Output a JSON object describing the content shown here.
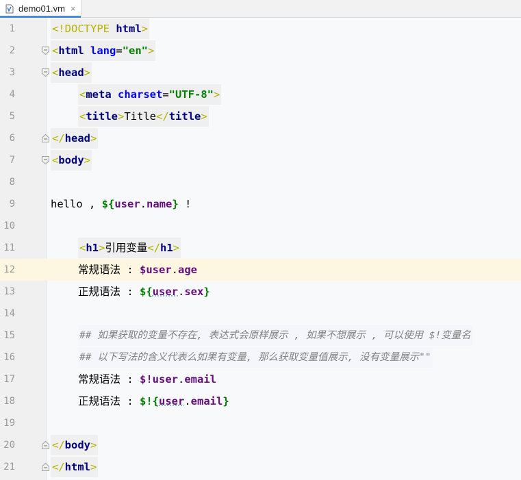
{
  "tab": {
    "filename": "demo01.vm",
    "close_glyph": "×",
    "icon": "velocity-file-icon"
  },
  "editor": {
    "current_line": 12,
    "lines": [
      {
        "num": "1"
      },
      {
        "num": "2"
      },
      {
        "num": "3"
      },
      {
        "num": "4"
      },
      {
        "num": "5"
      },
      {
        "num": "6"
      },
      {
        "num": "7"
      },
      {
        "num": "8"
      },
      {
        "num": "9"
      },
      {
        "num": "10"
      },
      {
        "num": "11"
      },
      {
        "num": "12"
      },
      {
        "num": "13"
      },
      {
        "num": "14"
      },
      {
        "num": "15"
      },
      {
        "num": "16"
      },
      {
        "num": "17"
      },
      {
        "num": "18"
      },
      {
        "num": "19"
      },
      {
        "num": "20"
      },
      {
        "num": "21"
      }
    ],
    "code": {
      "l1_open": "<!DOCTYPE ",
      "l1_kw": "html",
      "l1_close": ">",
      "l2_open": "<",
      "l2_kw": "html",
      "l2_attr": " lang",
      "l2_eq": "=",
      "l2_str": "\"en\"",
      "l2_close": ">",
      "l3_open": "<",
      "l3_kw": "head",
      "l3_close": ">",
      "l4_open": "<",
      "l4_kw": "meta",
      "l4_attr": " charset",
      "l4_eq": "=",
      "l4_str": "\"UTF-8\"",
      "l4_close": ">",
      "l5_open": "<",
      "l5_kw": "title",
      "l5_close": ">",
      "l5_text": "Title",
      "l5_open2": "</",
      "l5_kw2": "title",
      "l5_close2": ">",
      "l6_open": "</",
      "l6_kw": "head",
      "l6_close": ">",
      "l7_open": "<",
      "l7_kw": "body",
      "l7_close": ">",
      "l9_text": "hello , ",
      "l9_dollar": "${",
      "l9_var1": "user",
      "l9_dot": ".",
      "l9_var2": "name",
      "l9_end": "}",
      "l9_tail": " !",
      "l11_open": "<",
      "l11_kw": "h1",
      "l11_close": ">",
      "l11_text": "引用变量",
      "l11_open2": "</",
      "l11_kw2": "h1",
      "l11_close2": ">",
      "l12_text": "常规语法 : ",
      "l12_dollar": "$",
      "l12_var1": "user",
      "l12_dot": ".",
      "l12_var2": "age",
      "l13_text": "正规语法 : ",
      "l13_dollar": "${",
      "l13_var1": "user",
      "l13_dot": ".",
      "l13_var2": "sex",
      "l13_end": "}",
      "l15_comment": "## 如果获取的变量不存在, 表达式会原样展示 , 如果不想展示 , 可以使用 $!变量名",
      "l16_comment": "## 以下写法的含义代表么如果有变量, 那么获取变量值展示, 没有变量展示\"\"",
      "l17_text": "常规语法 : ",
      "l17_dollar": "$!",
      "l17_var1": "user",
      "l17_dot": ".",
      "l17_var2": "email",
      "l18_text": "正规语法 : ",
      "l18_dollar": "$!{",
      "l18_var1": "user",
      "l18_dot": ".",
      "l18_var2": "email",
      "l18_end": "}",
      "l20_open": "</",
      "l20_kw": "body",
      "l20_close": ">",
      "l21_open": "</",
      "l21_kw": "html",
      "l21_close": ">"
    }
  },
  "colors": {
    "tag_bracket": "#b3b300",
    "tag_keyword": "#000080",
    "attribute": "#0000ff",
    "string": "#008000",
    "velocity_var": "#660e7a",
    "comment": "#808080",
    "current_line_bg": "#fdf7e2",
    "tab_indicator": "#4a86e8"
  }
}
